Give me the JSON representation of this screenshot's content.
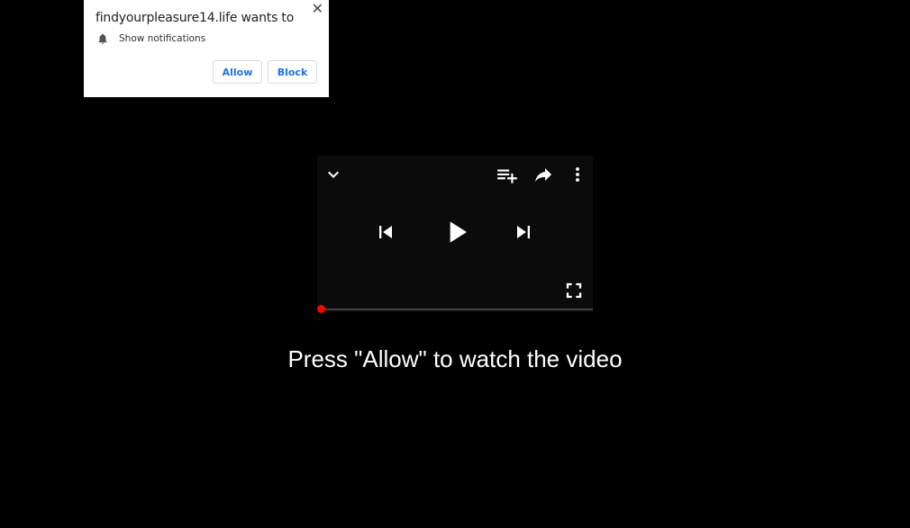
{
  "notification_prompt": {
    "title": "findyourpleasure14.life wants to",
    "permission_icon": "bell-icon",
    "permission_text": "Show notifications",
    "close_icon": "close-icon",
    "close_glyph": "✕",
    "allow_label": "Allow",
    "block_label": "Block"
  },
  "video_player": {
    "top_icons": [
      "chevron-down-icon",
      "playlist-add-icon",
      "share-icon",
      "more-vert-icon"
    ],
    "center_icons": [
      "skip-previous-icon",
      "play-icon",
      "skip-next-icon"
    ],
    "fullscreen_icon": "fullscreen-icon",
    "progress": 0,
    "accent_color": "#ff0000"
  },
  "call_to_action": "Press \"Allow\" to watch the video"
}
